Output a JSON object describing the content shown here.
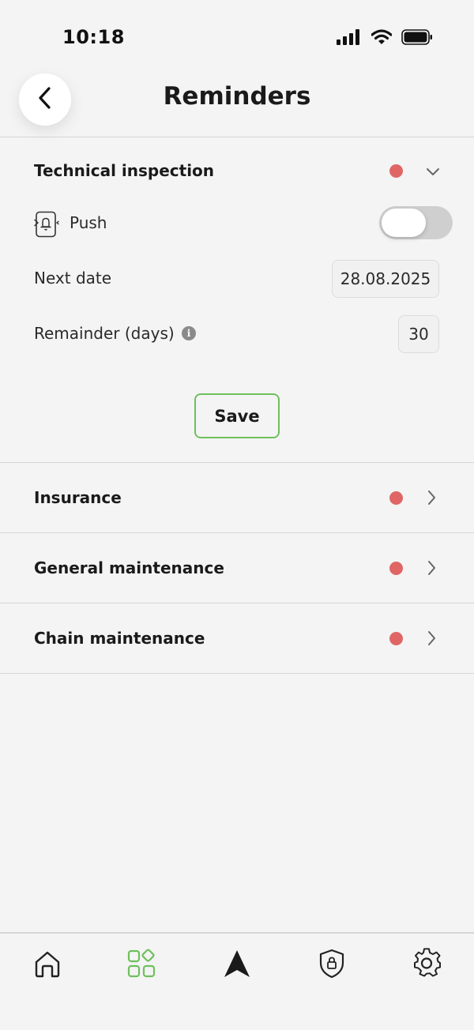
{
  "status_bar": {
    "time": "10:18"
  },
  "header": {
    "title": "Reminders"
  },
  "technical_inspection": {
    "title": "Technical inspection",
    "push_label": "Push",
    "push_enabled": false,
    "next_date_label": "Next date",
    "next_date_value": "28.08.2025",
    "reminder_label": "Remainder (days)",
    "reminder_value": "30",
    "info_glyph": "i",
    "save_label": "Save"
  },
  "sections": [
    {
      "title": "Insurance"
    },
    {
      "title": "General maintenance"
    },
    {
      "title": "Chain maintenance"
    }
  ],
  "colors": {
    "accent_green": "#6ec05c",
    "status_dot_red": "#e06666",
    "background": "#f4f4f4"
  },
  "tabs": [
    {
      "icon": "home-icon",
      "active": false
    },
    {
      "icon": "apps-grid-icon",
      "active": true
    },
    {
      "icon": "navigation-arrow-icon",
      "active": false
    },
    {
      "icon": "shield-lock-icon",
      "active": false
    },
    {
      "icon": "gear-icon",
      "active": false
    }
  ]
}
